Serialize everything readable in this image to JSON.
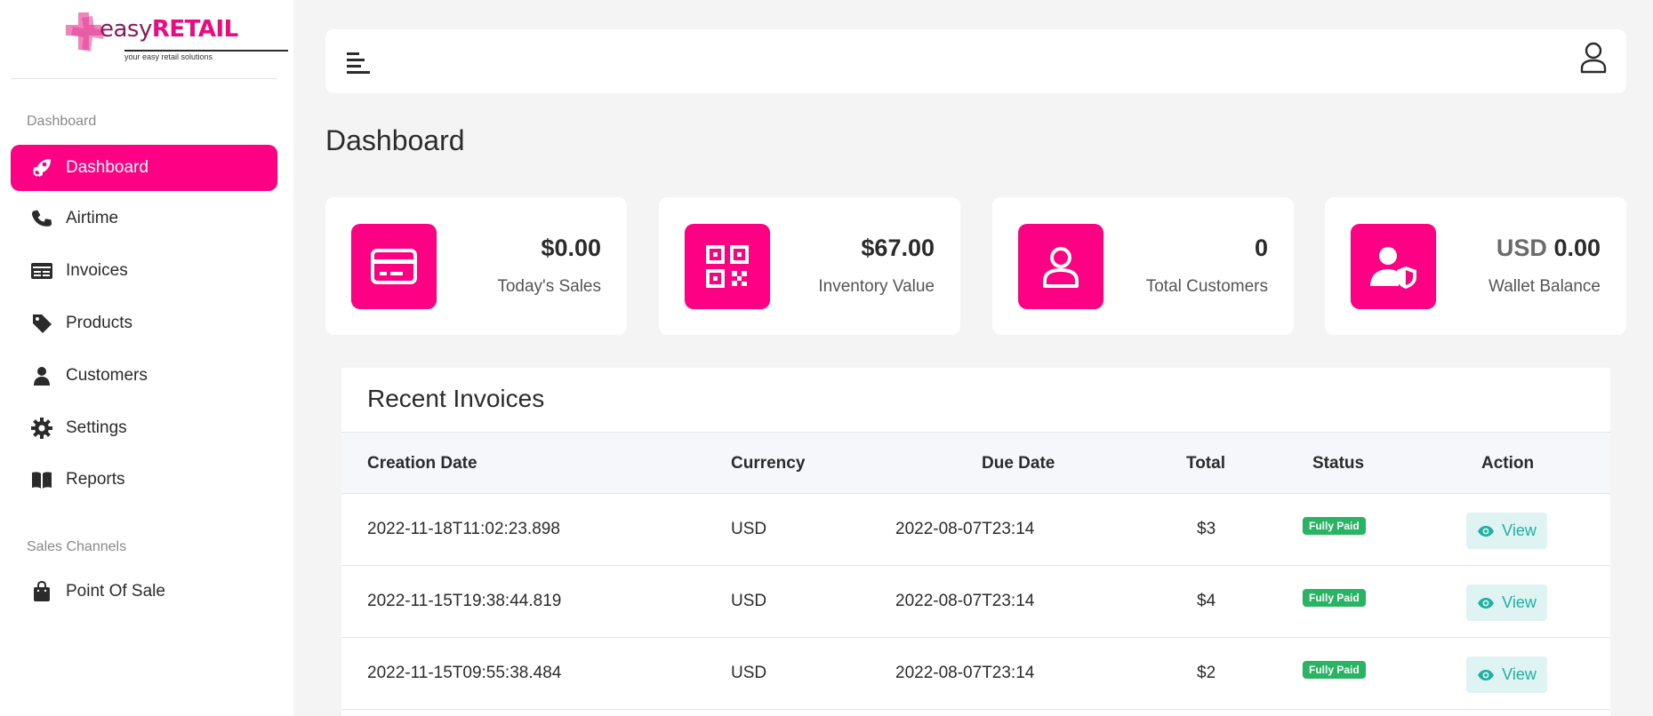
{
  "brand": {
    "word_a": "easy",
    "word_b": "RETAIL",
    "tagline": "your easy retail solutions"
  },
  "sidebar": {
    "section_main": "Dashboard",
    "items": [
      {
        "label": "Dashboard",
        "icon": "rocket-icon"
      },
      {
        "label": "Airtime",
        "icon": "phone-icon"
      },
      {
        "label": "Invoices",
        "icon": "invoice-icon"
      },
      {
        "label": "Products",
        "icon": "tag-icon"
      },
      {
        "label": "Customers",
        "icon": "user-icon"
      },
      {
        "label": "Settings",
        "icon": "gear-icon"
      },
      {
        "label": "Reports",
        "icon": "book-icon"
      }
    ],
    "section_sales": "Sales Channels",
    "sales_items": [
      {
        "label": "Point Of Sale",
        "icon": "bag-icon"
      }
    ]
  },
  "page": {
    "title": "Dashboard"
  },
  "cards": [
    {
      "value": "$0.00",
      "label": "Today's Sales",
      "icon": "credit-card-icon"
    },
    {
      "value": "$67.00",
      "label": "Inventory Value",
      "icon": "qr-code-icon"
    },
    {
      "value": "0",
      "label": "Total Customers",
      "icon": "user-outline-icon"
    },
    {
      "currency": "USD",
      "value": "0.00",
      "label": "Wallet Balance",
      "icon": "user-shield-icon"
    }
  ],
  "invoices": {
    "title": "Recent Invoices",
    "columns": [
      "Creation Date",
      "Currency",
      "Due Date",
      "Total",
      "Status",
      "Action"
    ],
    "rows": [
      {
        "creation": "2022-11-18T11:02:23.898",
        "currency": "USD",
        "due": "2022-08-07T23:14",
        "total": "$3",
        "status": "Fully Paid",
        "action": "View"
      },
      {
        "creation": "2022-11-15T19:38:44.819",
        "currency": "USD",
        "due": "2022-08-07T23:14",
        "total": "$4",
        "status": "Fully Paid",
        "action": "View"
      },
      {
        "creation": "2022-11-15T09:55:38.484",
        "currency": "USD",
        "due": "2022-08-07T23:14",
        "total": "$2",
        "status": "Fully Paid",
        "action": "View"
      }
    ]
  },
  "colors": {
    "accent": "#fd0084",
    "paid": "#28b463",
    "view": "#1db1a3"
  }
}
